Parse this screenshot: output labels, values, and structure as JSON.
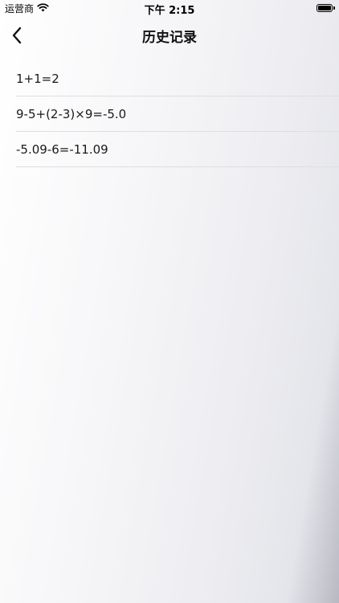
{
  "status_bar": {
    "carrier": "运营商",
    "time": "下午 2:15",
    "battery_level": 1.0
  },
  "nav": {
    "title": "历史记录",
    "back_icon": "chevron-left-icon"
  },
  "history": {
    "items": [
      {
        "expression": "1+1=2"
      },
      {
        "expression": "9-5+(2-3)×9=-5.0"
      },
      {
        "expression": "-5.09-6=-11.09"
      }
    ]
  }
}
